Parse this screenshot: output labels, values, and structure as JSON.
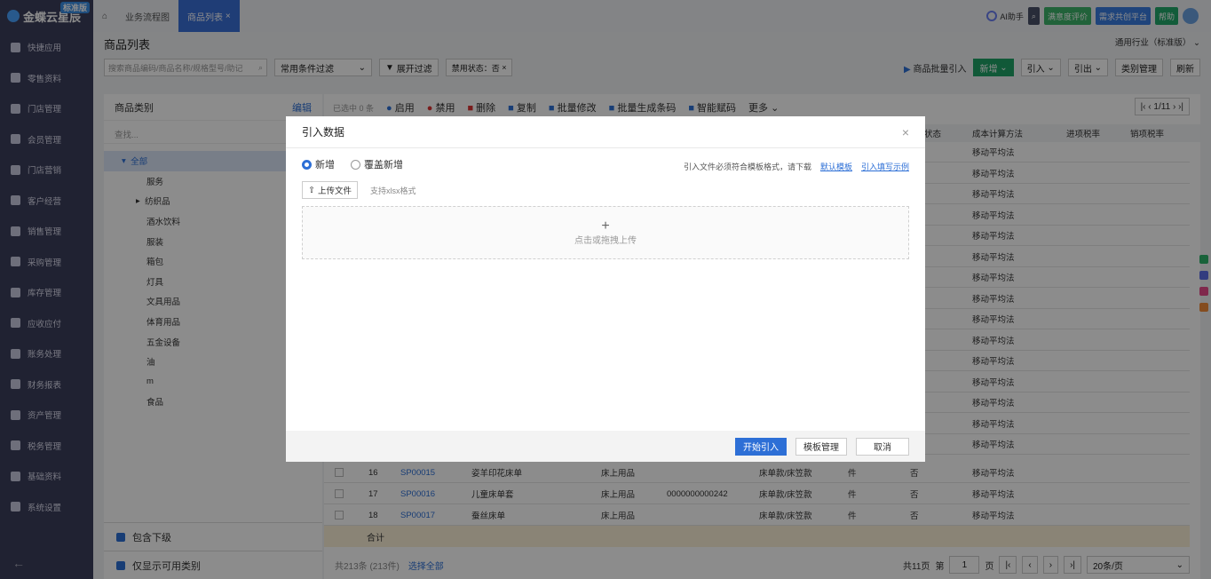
{
  "brand": {
    "name": "金蝶云星辰",
    "edition": "标准版"
  },
  "sidebar": {
    "items": [
      {
        "label": "快捷应用",
        "icon": "grid-icon"
      },
      {
        "label": "零售资料",
        "icon": "basket-icon"
      },
      {
        "label": "门店管理",
        "icon": "store-icon"
      },
      {
        "label": "会员管理",
        "icon": "heart-icon"
      },
      {
        "label": "门店营销",
        "icon": "megaphone-icon"
      },
      {
        "label": "客户经营",
        "icon": "person-icon"
      },
      {
        "label": "销售管理",
        "icon": "sales-icon"
      },
      {
        "label": "采购管理",
        "icon": "cart-icon"
      },
      {
        "label": "库存管理",
        "icon": "box-icon"
      },
      {
        "label": "应收应付",
        "icon": "coin-icon"
      },
      {
        "label": "账务处理",
        "icon": "ledger-icon"
      },
      {
        "label": "财务报表",
        "icon": "report-icon"
      },
      {
        "label": "资产管理",
        "icon": "asset-icon"
      },
      {
        "label": "税务管理",
        "icon": "tax-icon"
      },
      {
        "label": "基础资料",
        "icon": "layers-icon"
      },
      {
        "label": "系统设置",
        "icon": "gear-icon"
      }
    ]
  },
  "topbar": {
    "tabs": [
      {
        "label": "业务流程图"
      },
      {
        "label": "商品列表"
      }
    ],
    "ai": "AI助手",
    "survey": "满意度评价",
    "demand": "需求共创平台",
    "help": "帮助"
  },
  "page": {
    "title": "商品列表",
    "industry": "通用行业（标准版）"
  },
  "filters": {
    "search_placeholder": "搜索商品编码/商品名称/规格型号/助记",
    "common": "常用条件过滤",
    "expand": "展开过滤",
    "tag": "禁用状态：否"
  },
  "actions": {
    "bulk_import": "商品批量引入",
    "new": "新增",
    "import": "引入",
    "export": "引出",
    "category": "类别管理",
    "refresh": "刷新"
  },
  "category_panel": {
    "title": "商品类别",
    "edit": "编辑",
    "search": "查找...",
    "root": "全部",
    "items": [
      "服务",
      "纺织品",
      "酒水饮料",
      "服装",
      "箱包",
      "灯具",
      "文具用品",
      "体育用品",
      "五金设备",
      "油",
      "m",
      "食品"
    ],
    "include_sub": "包含下级",
    "only_available": "仅显示可用类别"
  },
  "table": {
    "selected": "已选中 0 条",
    "toolbar": [
      "启用",
      "禁用",
      "删除",
      "复制",
      "批量修改",
      "批量生成条码",
      "智能赋码",
      "更多"
    ],
    "pager_top": "1/11",
    "headers": [
      "状态",
      "成本计算方法",
      "进项税率",
      "销项税率"
    ],
    "cost_method": "移动平均法",
    "rows": [
      {
        "no": "16",
        "code": "SP00015",
        "name": "姿羊印花床单",
        "cat": "床上用品",
        "barcode": "",
        "spec": "床单款/床笠款",
        "unit": "件",
        "flag": "否"
      },
      {
        "no": "17",
        "code": "SP00016",
        "name": "儿童床单套",
        "cat": "床上用品",
        "barcode": "0000000000242",
        "spec": "床单款/床笠款",
        "unit": "件",
        "flag": "否"
      },
      {
        "no": "18",
        "code": "SP00017",
        "name": "蚕丝床单",
        "cat": "床上用品",
        "barcode": "",
        "spec": "床单款/床笠款",
        "unit": "件",
        "flag": "否"
      }
    ],
    "total_label": "合计",
    "summary": "共213条 (213件)",
    "select_all": "选择全部",
    "pages_total": "共11页",
    "page_prefix": "第",
    "page_value": "1",
    "page_suffix": "页",
    "page_size": "20条/页"
  },
  "modal": {
    "title": "引入数据",
    "radio_new": "新增",
    "radio_overwrite": "覆盖新增",
    "hint": "引入文件必须符合模板格式，请下载",
    "default_template": "默认模板",
    "example": "引入填写示例",
    "upload": "上传文件",
    "upload_hint": "支持xlsx格式",
    "drop": "点击或拖拽上传",
    "start": "开始引入",
    "template_mgmt": "模板管理",
    "cancel": "取消"
  }
}
